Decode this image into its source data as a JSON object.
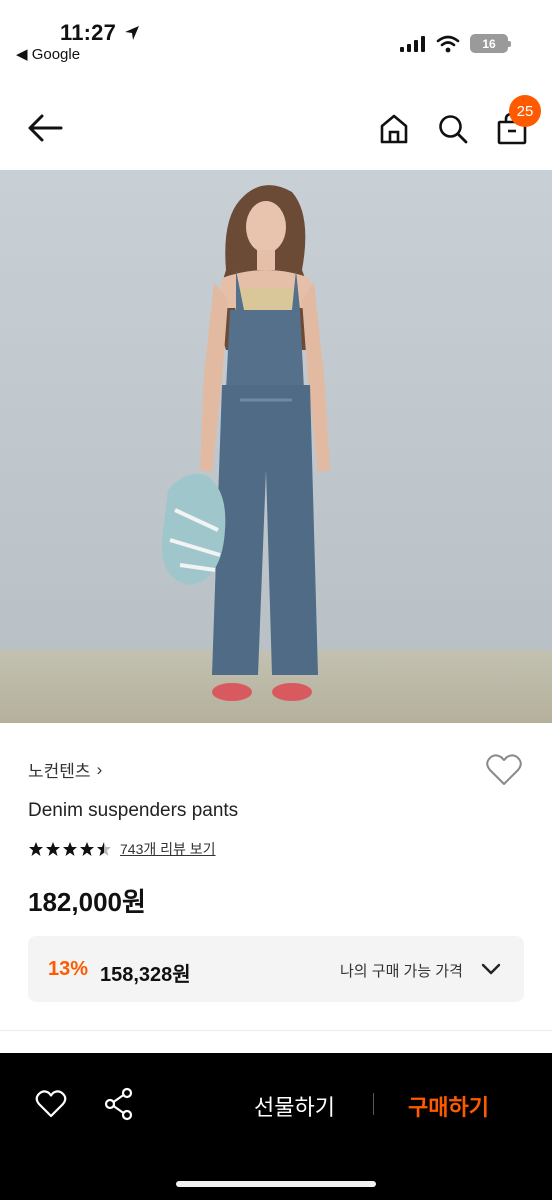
{
  "status_bar": {
    "time": "11:27",
    "back_app": "◀ Google",
    "battery": "16"
  },
  "header": {
    "cart_count": "25"
  },
  "product": {
    "brand": "노컨텐츠",
    "brand_chevron": "›",
    "name": "Denim suspenders pants",
    "rating": 4.5,
    "review_link": "743개 리뷰 보기",
    "price": "182,000원",
    "discount_percent": "13%",
    "discount_price": "158,328원",
    "my_price_label": "나의 구매 가능 가격"
  },
  "bottom_bar": {
    "gift_label": "선물하기",
    "buy_label": "구매하기"
  },
  "colors": {
    "accent": "#ff5a00",
    "bottom_bar_bg": "#000000",
    "price_box_bg": "#f4f4f4"
  },
  "icons": [
    "location-arrow-icon",
    "signal-icon",
    "wifi-icon",
    "battery-icon",
    "back-arrow-icon",
    "home-icon",
    "search-icon",
    "shopping-bag-icon",
    "heart-outline-icon",
    "star-icon",
    "chevron-down-icon",
    "share-icon"
  ]
}
